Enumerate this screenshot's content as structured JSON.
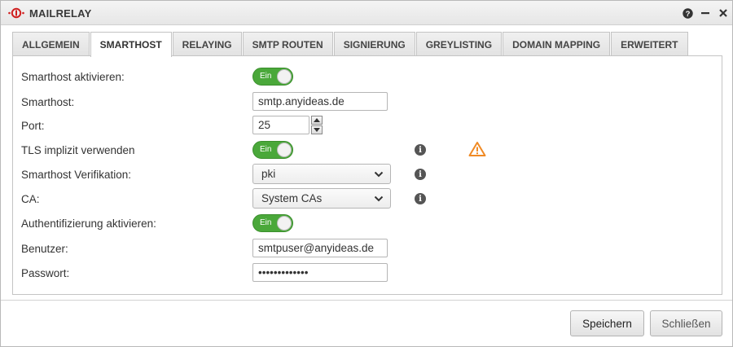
{
  "window": {
    "title": "MAILRELAY",
    "logo_icon": "securepoint-logo-icon",
    "controls": [
      "help-icon",
      "minimize-icon",
      "close-icon"
    ]
  },
  "tabs": [
    {
      "label": "ALLGEMEIN",
      "active": false
    },
    {
      "label": "SMARTHOST",
      "active": true
    },
    {
      "label": "RELAYING",
      "active": false
    },
    {
      "label": "SMTP ROUTEN",
      "active": false
    },
    {
      "label": "SIGNIERUNG",
      "active": false
    },
    {
      "label": "GREYLISTING",
      "active": false
    },
    {
      "label": "DOMAIN MAPPING",
      "active": false
    },
    {
      "label": "ERWEITERT",
      "active": false
    }
  ],
  "form": {
    "smarthost_enable": {
      "label": "Smarthost aktivieren:",
      "toggle_text": "Ein",
      "on": true
    },
    "smarthost": {
      "label": "Smarthost:",
      "value": "smtp.anyideas.de"
    },
    "port": {
      "label": "Port:",
      "value": "25"
    },
    "tls_implicit": {
      "label": "TLS implizit verwenden",
      "toggle_text": "Ein",
      "on": true
    },
    "verification": {
      "label": "Smarthost Verifikation:",
      "value": "pki"
    },
    "ca": {
      "label": "CA:",
      "value": "System CAs"
    },
    "auth_enable": {
      "label": "Authentifizierung aktivieren:",
      "toggle_text": "Ein",
      "on": true
    },
    "user": {
      "label": "Benutzer:",
      "value": "smtpuser@anyideas.de"
    },
    "password": {
      "label": "Passwort:",
      "value": "secretpasswor"
    }
  },
  "footer": {
    "save_label": "Speichern",
    "close_label": "Schließen"
  },
  "colors": {
    "toggle_on": "#4aa83a",
    "warning": "#f08a24",
    "info": "#555555"
  }
}
